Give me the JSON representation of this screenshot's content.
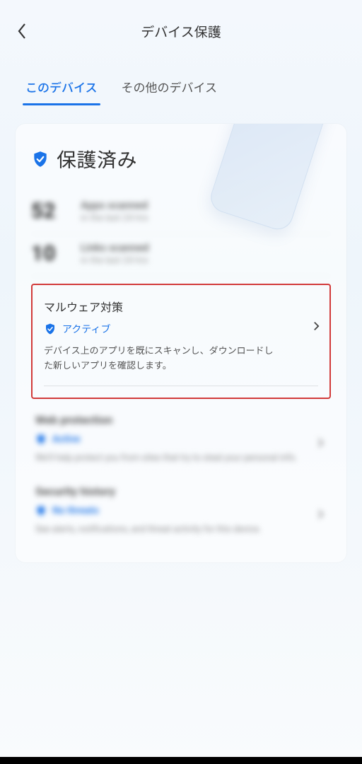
{
  "header": {
    "title": "デバイス保護"
  },
  "tabs": {
    "this_device": "このデバイス",
    "other_devices": "その他のデバイス"
  },
  "status": {
    "label": "保護済み"
  },
  "stats": [
    {
      "value": "52",
      "line1": "Apps scanned",
      "line2": "in the last 24 hrs"
    },
    {
      "value": "10",
      "line1": "Links scanned",
      "line2": "in the last 24 hrs"
    }
  ],
  "feature_malware": {
    "title": "マルウェア対策",
    "status": "アクティブ",
    "desc": "デバイス上のアプリを既にスキャンし、ダウンロードした新しいアプリを確認します。"
  },
  "feature_web": {
    "title": "Web protection",
    "status": "Active",
    "desc": "We'll help protect you from sites that try to steal your personal info."
  },
  "feature_history": {
    "title": "Security history",
    "status": "No threats",
    "desc": "See alerts, notifications, and threat activity for this device."
  },
  "colors": {
    "accent": "#1a73e8",
    "highlight_border": "#d23a3a"
  }
}
